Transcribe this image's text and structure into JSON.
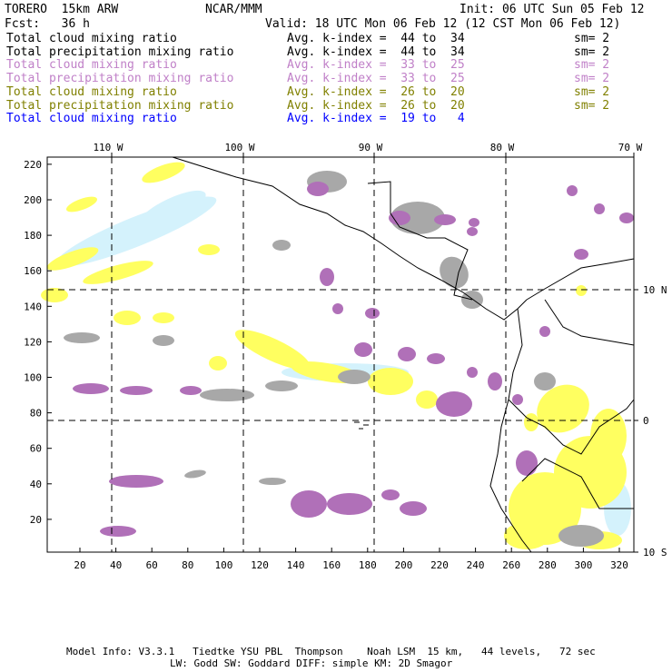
{
  "header": {
    "model": "TORERO  15km ARW",
    "org": "NCAR/MMM",
    "init": "Init: 06 UTC Sun 05 Feb 12",
    "fcst": "Fcst:   36 h",
    "valid": "Valid: 18 UTC Mon 06 Feb 12 (12 CST Mon 06 Feb 12)"
  },
  "legend": [
    {
      "name": "Total cloud mixing ratio",
      "range": "Avg. k-index =  44 to  34",
      "sm": "sm= 2",
      "color": "#000000"
    },
    {
      "name": "Total precipitation mixing ratio",
      "range": "Avg. k-index =  44 to  34",
      "sm": "sm= 2",
      "color": "#000000"
    },
    {
      "name": "Total cloud mixing ratio",
      "range": "Avg. k-index =  33 to  25",
      "sm": "sm= 2",
      "color": "#c080c8"
    },
    {
      "name": "Total precipitation mixing ratio",
      "range": "Avg. k-index =  33 to  25",
      "sm": "sm= 2",
      "color": "#c080c8"
    },
    {
      "name": "Total cloud mixing ratio",
      "range": "Avg. k-index =  26 to  20",
      "sm": "sm= 2",
      "color": "#808000"
    },
    {
      "name": "Total precipitation mixing ratio",
      "range": "Avg. k-index =  26 to  20",
      "sm": "sm= 2",
      "color": "#808000"
    },
    {
      "name": "Total cloud mixing ratio",
      "range": "Avg. k-index =  19 to   4",
      "sm": "",
      "color": "#0000ff"
    }
  ],
  "map": {
    "lon_labels": [
      "110 W",
      "100 W",
      "90 W",
      "80 W",
      "70 W"
    ],
    "lat_labels": [
      "10 N",
      "0",
      "10 S"
    ],
    "x_ticks": [
      "20",
      "40",
      "60",
      "80",
      "100",
      "120",
      "140",
      "160",
      "180",
      "200",
      "220",
      "240",
      "260",
      "280",
      "300",
      "320"
    ],
    "y_ticks": [
      "220",
      "200",
      "180",
      "160",
      "140",
      "120",
      "100",
      "80",
      "60",
      "40",
      "20"
    ],
    "colors": {
      "gray": "#a8a8a8",
      "purple": "#b070b8",
      "yellow": "#ffff60",
      "lightblue": "#d4f2fc"
    }
  },
  "footer": {
    "line1": "Model Info: V3.3.1   Tiedtke YSU PBL  Thompson    Noah LSM  15 km,   44 levels,   72 sec",
    "line2": "LW: Godd SW: Goddard DIFF: simple KM: 2D Smagor"
  }
}
